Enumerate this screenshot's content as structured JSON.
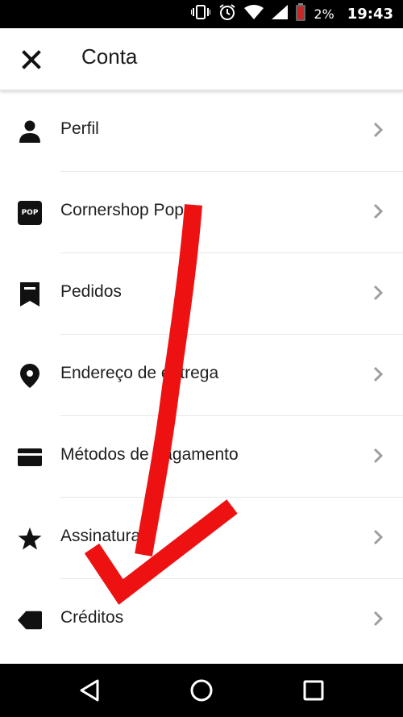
{
  "status_bar": {
    "battery_percent": "2%",
    "time": "19:43",
    "icons": [
      "vibrate-icon",
      "alarm-icon",
      "wifi-icon",
      "signal-icon",
      "battery-low-icon"
    ]
  },
  "header": {
    "title": "Conta",
    "close_icon": "close-icon"
  },
  "menu": {
    "items": [
      {
        "label": "Perfil",
        "icon": "person-icon"
      },
      {
        "label": "Cornershop Pop",
        "icon": "pop-badge-icon",
        "badge_text": "POP"
      },
      {
        "label": "Pedidos",
        "icon": "receipt-icon"
      },
      {
        "label": "Endereço de entrega",
        "icon": "location-pin-icon"
      },
      {
        "label": "Métodos de pagamento",
        "icon": "credit-card-icon"
      },
      {
        "label": "Assinaturas",
        "icon": "star-icon"
      },
      {
        "label": "Créditos",
        "icon": "tag-icon"
      }
    ]
  },
  "nav_bar": {
    "back_icon": "back-triangle-icon",
    "home_icon": "home-circle-icon",
    "recents_icon": "recents-square-icon"
  },
  "colors": {
    "annotation": "#ee1111",
    "chevron": "#9e9e9e",
    "text": "#1f1f1f"
  }
}
